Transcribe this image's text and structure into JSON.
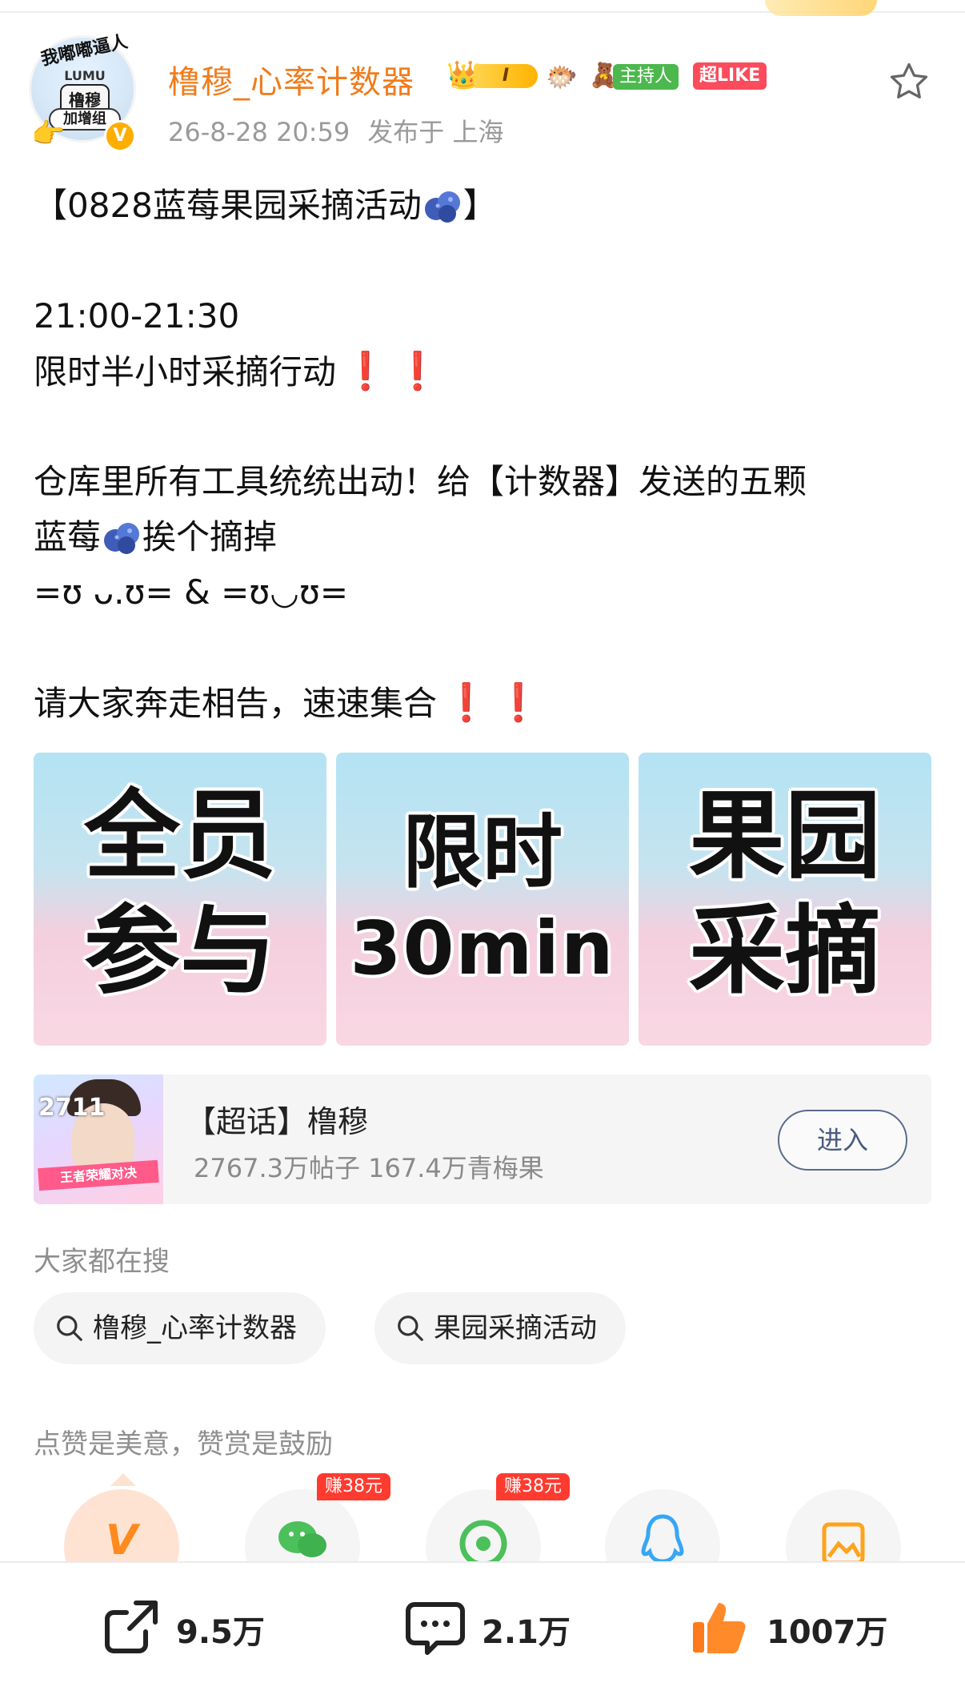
{
  "header": {
    "username": "橹穆_心率计数器",
    "level_badge": "I",
    "host_badge": "主持人",
    "like_badge": "超LIKE",
    "timestamp": "26-8-28 20:59",
    "location": "发布于 上海",
    "avatar": {
      "ring_text": "我嘟嘟逼人",
      "label_top": "LUMU",
      "label_center": "橹穆",
      "label_bottom": "加增组",
      "verified_mark": "V"
    }
  },
  "post": {
    "title_prefix": "【0828蓝莓果园采摘活动",
    "title_suffix": "】",
    "time_range": "21:00-21:30",
    "line_limited": "限时半小时采摘行动",
    "line_tools": "仓库里所有工具统统出动！给【计数器】发送的五颗",
    "line_berries_prefix": "蓝莓",
    "line_berries_suffix": "挨个摘掉",
    "kaomoji": "=ʊ ᴗ.ʊ= & =ʊ◡ʊ=",
    "line_gather": "请大家奔走相告，速速集合",
    "exclaim": "❗"
  },
  "images": [
    {
      "line1": "全员",
      "line2": "参与"
    },
    {
      "line1": "限时",
      "line2": "30min"
    },
    {
      "line1": "果园",
      "line2": "采摘"
    }
  ],
  "topic": {
    "title": "【超话】橹穆",
    "stats": "2767.3万帖子 167.4万青梅果",
    "enter_label": "进入",
    "thumb_number": "2711",
    "thumb_banner": "王者荣耀对决"
  },
  "searches": {
    "heading": "大家都在搜",
    "items": [
      "橹穆_心率计数器",
      "果园采摘活动"
    ]
  },
  "reward": {
    "heading": "点赞是美意，赞赏是鼓励",
    "earn_tag": "赚38元",
    "icons": [
      "reward-v-icon",
      "wechat-icon",
      "moments-icon",
      "qq-icon",
      "image-icon"
    ]
  },
  "actions": {
    "share_count": "9.5万",
    "comment_count": "2.1万",
    "like_count": "1007万"
  },
  "colors": {
    "username": "#f07c1c",
    "exclaim": "#e0141f",
    "like_badge": "#fa4c5c",
    "host_badge": "#4cb84d",
    "earn_tag": "#ff3b2f",
    "like_thumb": "#ff7a1a"
  }
}
